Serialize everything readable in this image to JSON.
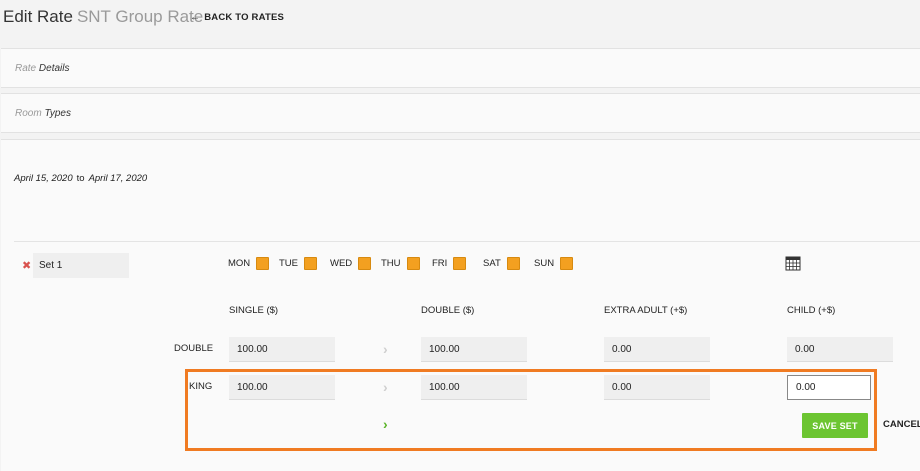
{
  "header": {
    "title": "Edit Rate",
    "subtitle": "SNT Group Rate",
    "back_label": "BACK TO RATES",
    "back_icon": "arrow-left-icon"
  },
  "panels": {
    "rate_details": {
      "light": "Rate",
      "bold": "Details"
    },
    "room_types": {
      "light": "Room",
      "bold": "Types"
    }
  },
  "dates": {
    "start": "April 15, 2020",
    "to": "to",
    "end": "April 17, 2020"
  },
  "set": {
    "name": "Set 1",
    "remove_icon": "close-icon"
  },
  "days": [
    {
      "label": "MON",
      "checked": true
    },
    {
      "label": "TUE",
      "checked": true
    },
    {
      "label": "WED",
      "checked": true
    },
    {
      "label": "THU",
      "checked": true
    },
    {
      "label": "FRI",
      "checked": true
    },
    {
      "label": "SAT",
      "checked": true
    },
    {
      "label": "SUN",
      "checked": true
    }
  ],
  "calendar_icon": "calendar-icon",
  "columns": [
    "SINGLE ($)",
    "DOUBLE ($)",
    "EXTRA ADULT (+$)",
    "CHILD (+$)"
  ],
  "rows": [
    {
      "label": "DOUBLE",
      "single": "100.00",
      "double": "100.00",
      "extra_adult": "0.00",
      "child": "0.00"
    },
    {
      "label": "KING",
      "single": "100.00",
      "double": "100.00",
      "extra_adult": "0.00",
      "child": "0.00"
    }
  ],
  "actions": {
    "save": "SAVE SET",
    "cancel": "CANCEL"
  },
  "colors": {
    "accent_orange": "#f3a020",
    "save_green": "#6cc531",
    "highlight": "#f07b22",
    "remove_red": "#d9534f"
  }
}
